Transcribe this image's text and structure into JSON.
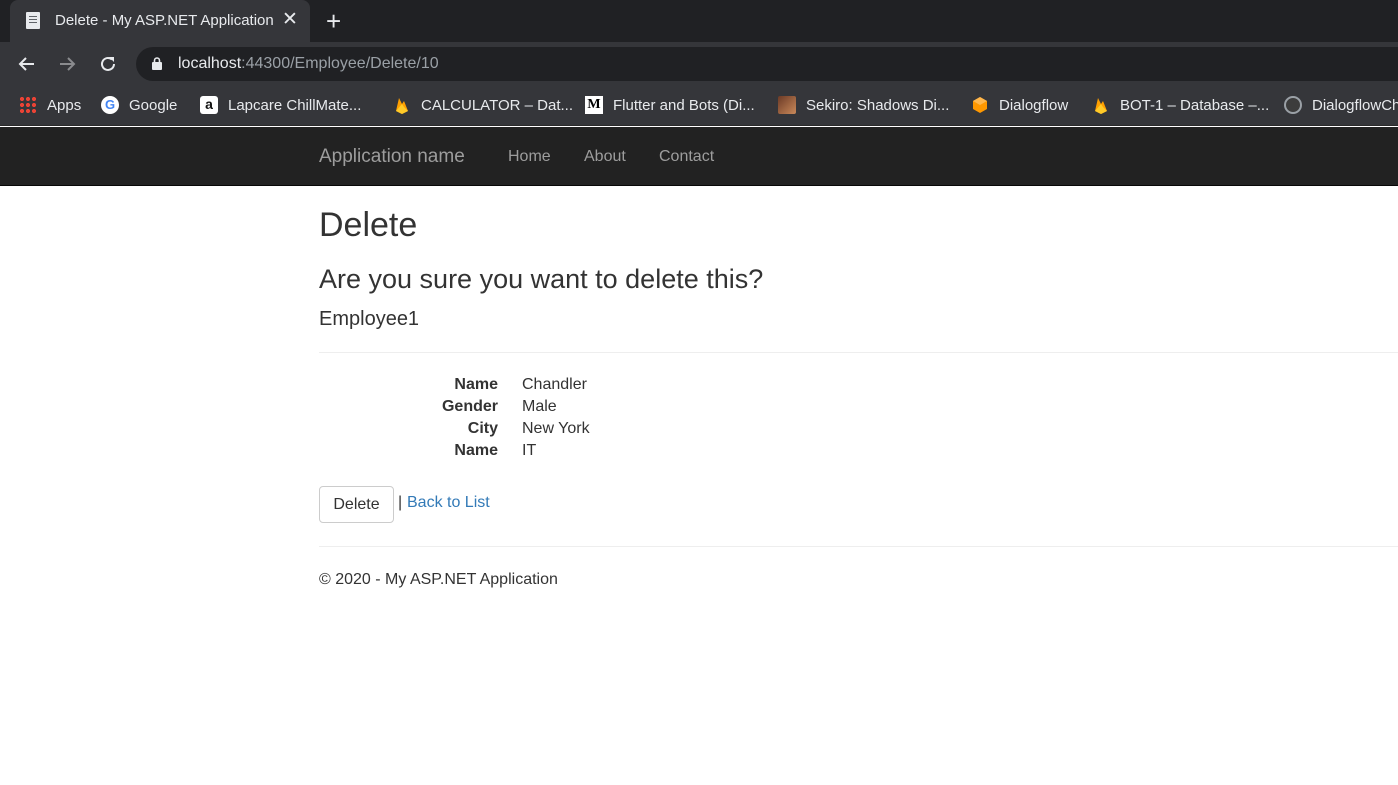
{
  "browser": {
    "tab_title": "Delete - My ASP.NET Application",
    "close_glyph": "✕",
    "newtab_glyph": "+",
    "url_host": "localhost",
    "url_rest": ":44300/Employee/Delete/10",
    "bookmarks": [
      {
        "label": "Apps",
        "icon": "apps-grid-icon"
      },
      {
        "label": "Google",
        "icon": "google-icon"
      },
      {
        "label": "Lapcare ChillMate...",
        "icon": "amazon-icon"
      },
      {
        "label": "CALCULATOR – Dat...",
        "icon": "firebase-icon"
      },
      {
        "label": "Flutter and Bots (Di...",
        "icon": "medium-icon"
      },
      {
        "label": "Sekiro: Shadows Di...",
        "icon": "game-icon"
      },
      {
        "label": "Dialogflow",
        "icon": "dialogflow-icon"
      },
      {
        "label": "BOT-1 – Database –...",
        "icon": "firebase-icon"
      },
      {
        "label": "DialogflowCh",
        "icon": "github-icon"
      }
    ]
  },
  "navbar": {
    "brand": "Application name",
    "links": [
      "Home",
      "About",
      "Contact"
    ]
  },
  "page": {
    "title": "Delete",
    "confirm": "Are you sure you want to delete this?",
    "entity": "Employee1",
    "fields": [
      {
        "label": "Name",
        "value": "Chandler"
      },
      {
        "label": "Gender",
        "value": "Male"
      },
      {
        "label": "City",
        "value": "New York"
      },
      {
        "label": "Name",
        "value": "IT"
      }
    ],
    "delete_button": "Delete",
    "separator": "|",
    "back_link": "Back to List"
  },
  "footer": {
    "text": "© 2020 - My ASP.NET Application"
  },
  "colors": {
    "link": "#337ab7",
    "navbar_bg": "#222222",
    "chrome_bg": "#35363a"
  }
}
